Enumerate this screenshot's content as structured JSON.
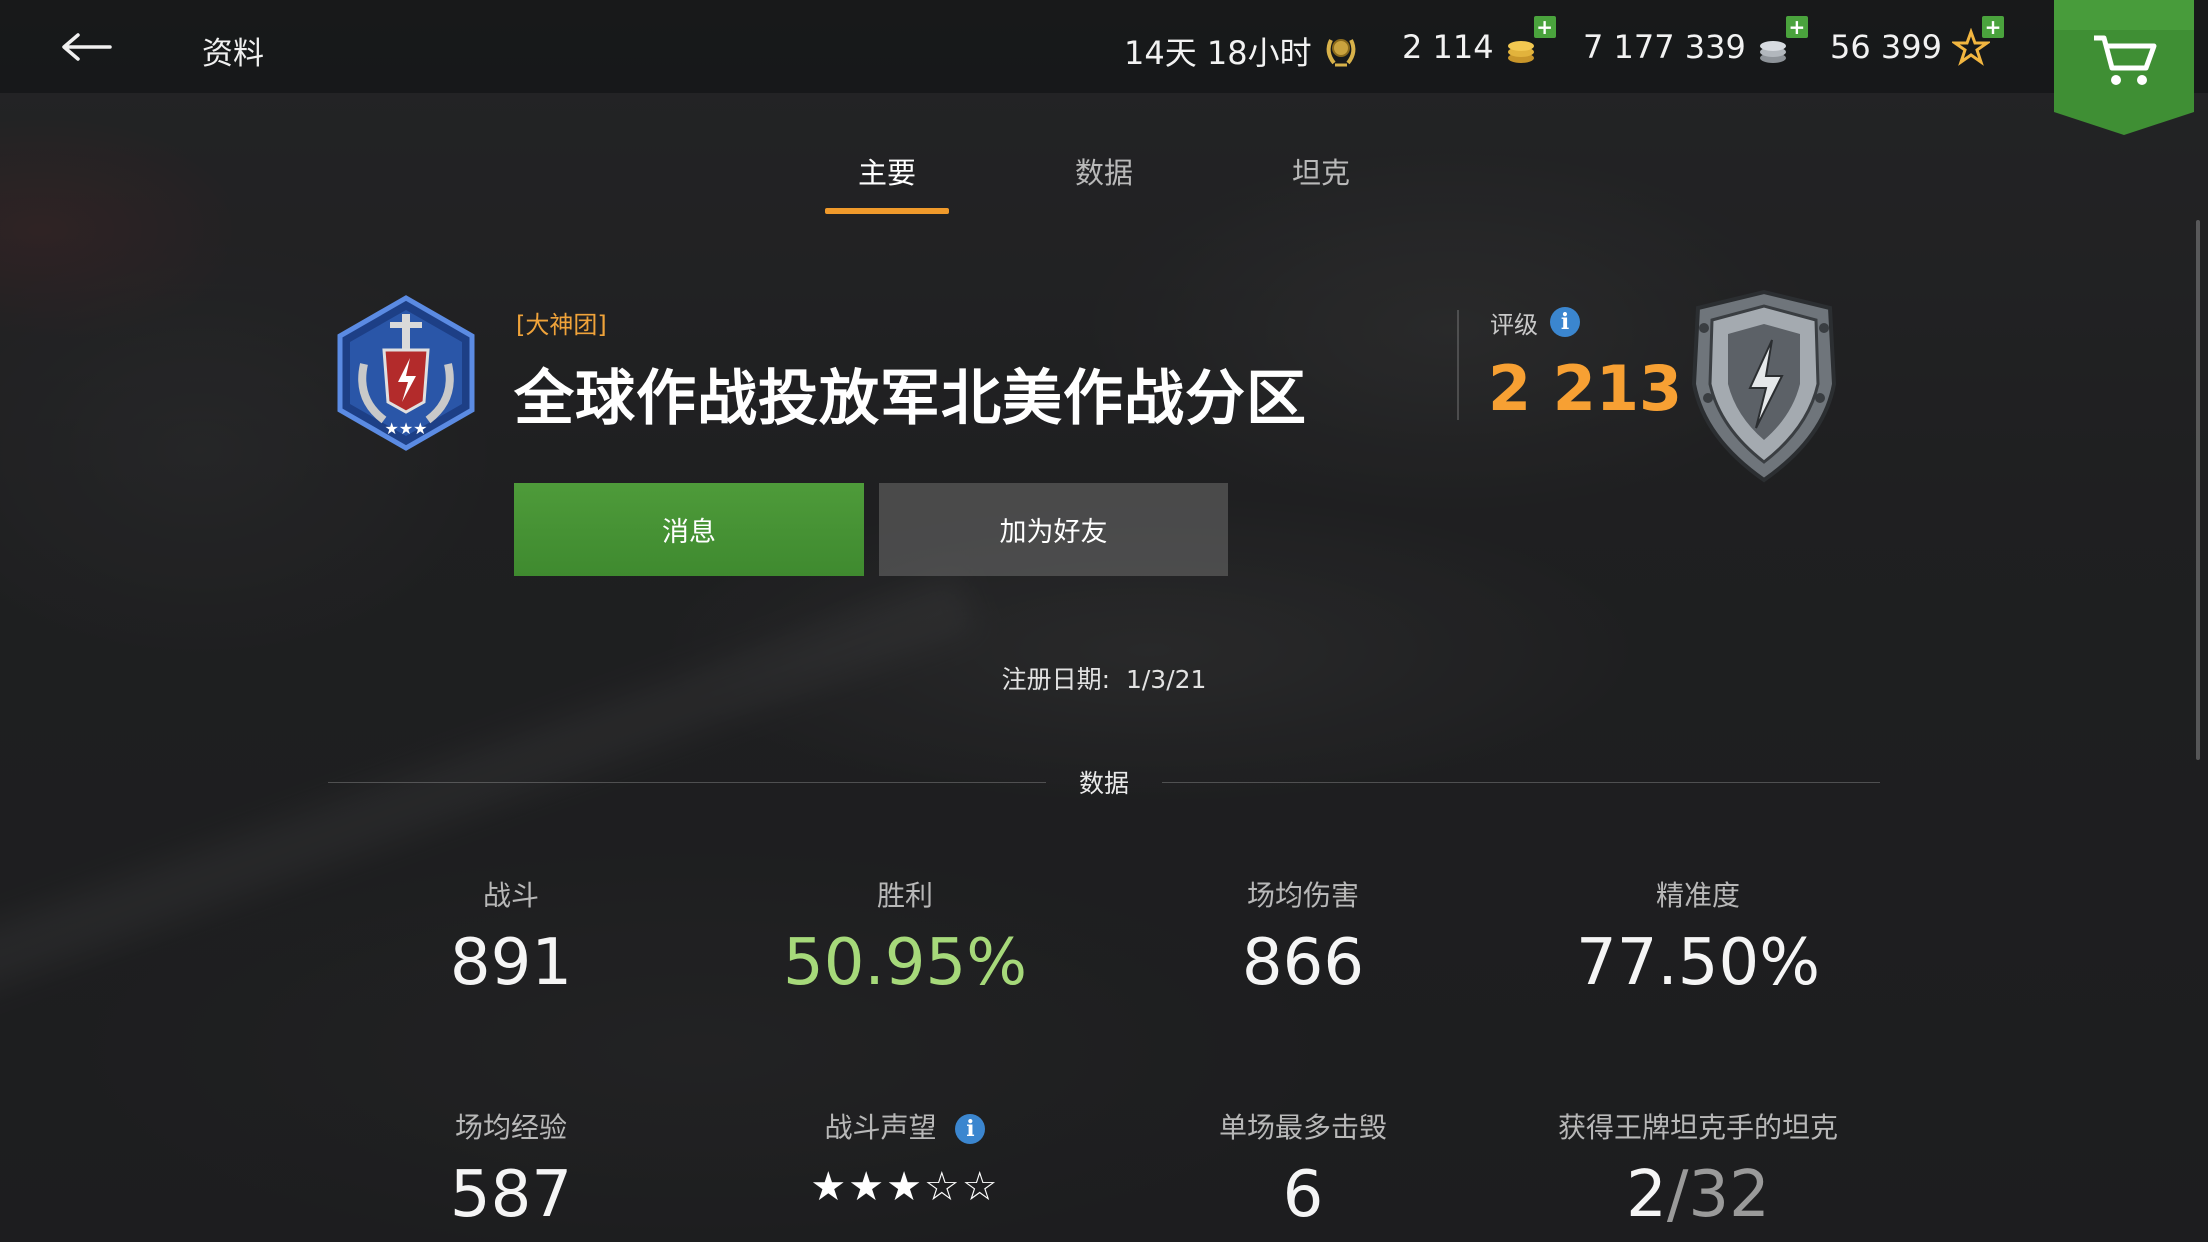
{
  "header": {
    "back_label": "←",
    "title": "资料",
    "premium_time": "14天 18小时",
    "gold": "2 114",
    "credits": "7 177 339",
    "free_xp": "56 399"
  },
  "tabs": [
    {
      "label": "主要",
      "active": true
    },
    {
      "label": "数据",
      "active": false
    },
    {
      "label": "坦克",
      "active": false
    }
  ],
  "profile": {
    "clan_tag": "[大神团]",
    "player_name": "全球作战投放军北美作战分区",
    "rating_label": "评级",
    "rating_value": "2 213",
    "message_button": "消息",
    "add_friend_button": "加为好友",
    "registration_label": "注册日期:",
    "registration_date": "1/3/21"
  },
  "stats_section": {
    "title": "数据",
    "row1": [
      {
        "label": "战斗",
        "value": "891"
      },
      {
        "label": "胜利",
        "value": "50.95%"
      },
      {
        "label": "场均伤害",
        "value": "866"
      },
      {
        "label": "精准度",
        "value": "77.50%"
      }
    ],
    "row2": [
      {
        "label": "场均经验",
        "value": "587"
      },
      {
        "label": "战斗声望",
        "stars": "★★★☆☆"
      },
      {
        "label": "单场最多击毁",
        "value": "6"
      },
      {
        "label": "获得王牌坦克手的坦克",
        "value_main": "2",
        "value_sep": "/",
        "value_total": "32"
      }
    ]
  },
  "colors": {
    "accent_orange": "#f09a2b",
    "rating_orange": "#f7a033",
    "win_green": "#a6d97a",
    "button_green": "#4e9b3a",
    "info_blue": "#3b86cf"
  },
  "icons": {
    "back": "arrow-left-icon",
    "premium": "premium-wreath-icon",
    "gold": "gold-coins-icon",
    "credits": "silver-coins-icon",
    "free_xp": "star-icon",
    "shop": "cart-icon",
    "info": "info-icon"
  }
}
